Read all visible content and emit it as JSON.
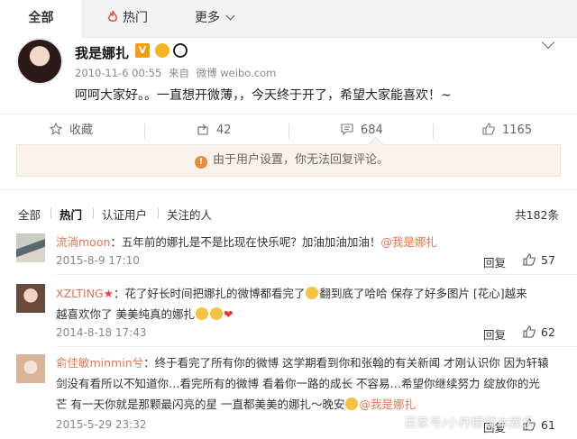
{
  "nav": {
    "tab_all": "全部",
    "tab_hot": "热门",
    "tab_more": "更多"
  },
  "post": {
    "username": "我是娜扎",
    "verified_badge": "V",
    "time": "2010-11-6 00:55",
    "source_prefix": "来自",
    "source": "微博 weibo.com",
    "text": "呵呵大家好。。一直想开微薄，，今天终于开了，希望大家能喜欢！~"
  },
  "actions": {
    "favorite": "收藏",
    "forward": "42",
    "comment": "684",
    "like": "1165"
  },
  "notice": "由于用户设置，你无法回复评论。",
  "filters": {
    "all": "全部",
    "hot": "热门",
    "verified": "认证用户",
    "following": "关注的人",
    "total": "共182条"
  },
  "comments": [
    {
      "name": "流淌moon",
      "text": "：五年前的娜扎是不是比现在快乐呢？加油加油加油！",
      "mention": "@我是娜扎",
      "time": "2015-8-9 17:10",
      "reply": "回复",
      "likes": "57"
    },
    {
      "name": "XZLTING",
      "text_1": "：花了好长时间把娜扎的微博都看完了",
      "text_1b": "翻到底了哈哈 保存了好多图片 [花心]越来",
      "text_2": "越喜欢你了 美美纯真的娜扎",
      "time": "2014-8-18 17:43",
      "reply": "回复",
      "likes": "62"
    },
    {
      "name": "俞佳敏minmin兮",
      "text_1": "：终于看完了所有你的微博 这学期看到你和张翰的有关新闻 才刚认识你 因为轩辕",
      "text_2": "剑没有看所以不知道你…看完所有的微博 看着你一路的成长 不容易…希望你继续努力 绽放你的光",
      "text_3": "芒 有一天你就是那颗最闪亮的星 一直都美美的娜扎～晚安",
      "mention": "@我是娜扎",
      "time": "2015-5-29 23:32",
      "reply": "回复",
      "likes": "61"
    }
  ],
  "watermark": "百家号/小柠檬说本娱乐",
  "colors": {
    "accent": "#eb7350",
    "notice_bg": "#f9f1eb",
    "badge": "#f39c12"
  }
}
